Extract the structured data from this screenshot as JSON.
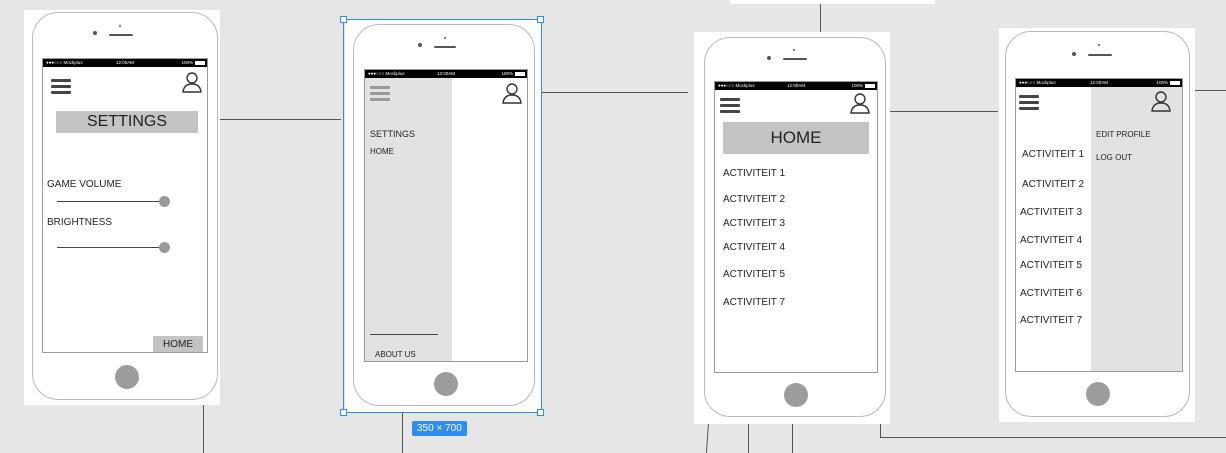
{
  "status_bar": {
    "carrier": "●●●○○○ Mockplus",
    "time": "12:00AM",
    "battery": "100%"
  },
  "screen1": {
    "title_box": "SETTINGS",
    "game_volume_label": "GAME VOLUME",
    "brightness_label": "BRIGHTNESS",
    "game_volume_level": 1.0,
    "brightness_level": 1.0,
    "home_button": "HOME"
  },
  "screen2": {
    "menu_items": [
      "SETTINGS",
      "HOME"
    ],
    "footer_item": "ABOUT US"
  },
  "screen3": {
    "title_box": "HOME",
    "items": [
      "ACTIVITEIT 1",
      "ACTIVITEIT 2",
      "ACTIVITEIT 3",
      "ACTIVITEIT 4",
      "ACTIVITEIT 5",
      "ACTIVITEIT 7"
    ]
  },
  "screen4": {
    "items": [
      "ACTIVITEIT 1",
      "ACTIVITEIT 2",
      "ACTIVITEIT 3",
      "ACTIVITEIT 4",
      "ACTIVITEIT 5",
      "ACTIVITEIT 6",
      "ACTIVITEIT 7"
    ],
    "menu_items": [
      "EDIT PROFILE",
      "LOG OUT"
    ]
  },
  "selection": {
    "dimension_label": "350 × 700"
  },
  "colors": {
    "selection": "#2f8cf0",
    "grey_box": "#c4c4c4",
    "menu_panel": "#e2e2e2"
  },
  "icons": [
    "hamburger-menu-icon",
    "user-profile-icon"
  ]
}
